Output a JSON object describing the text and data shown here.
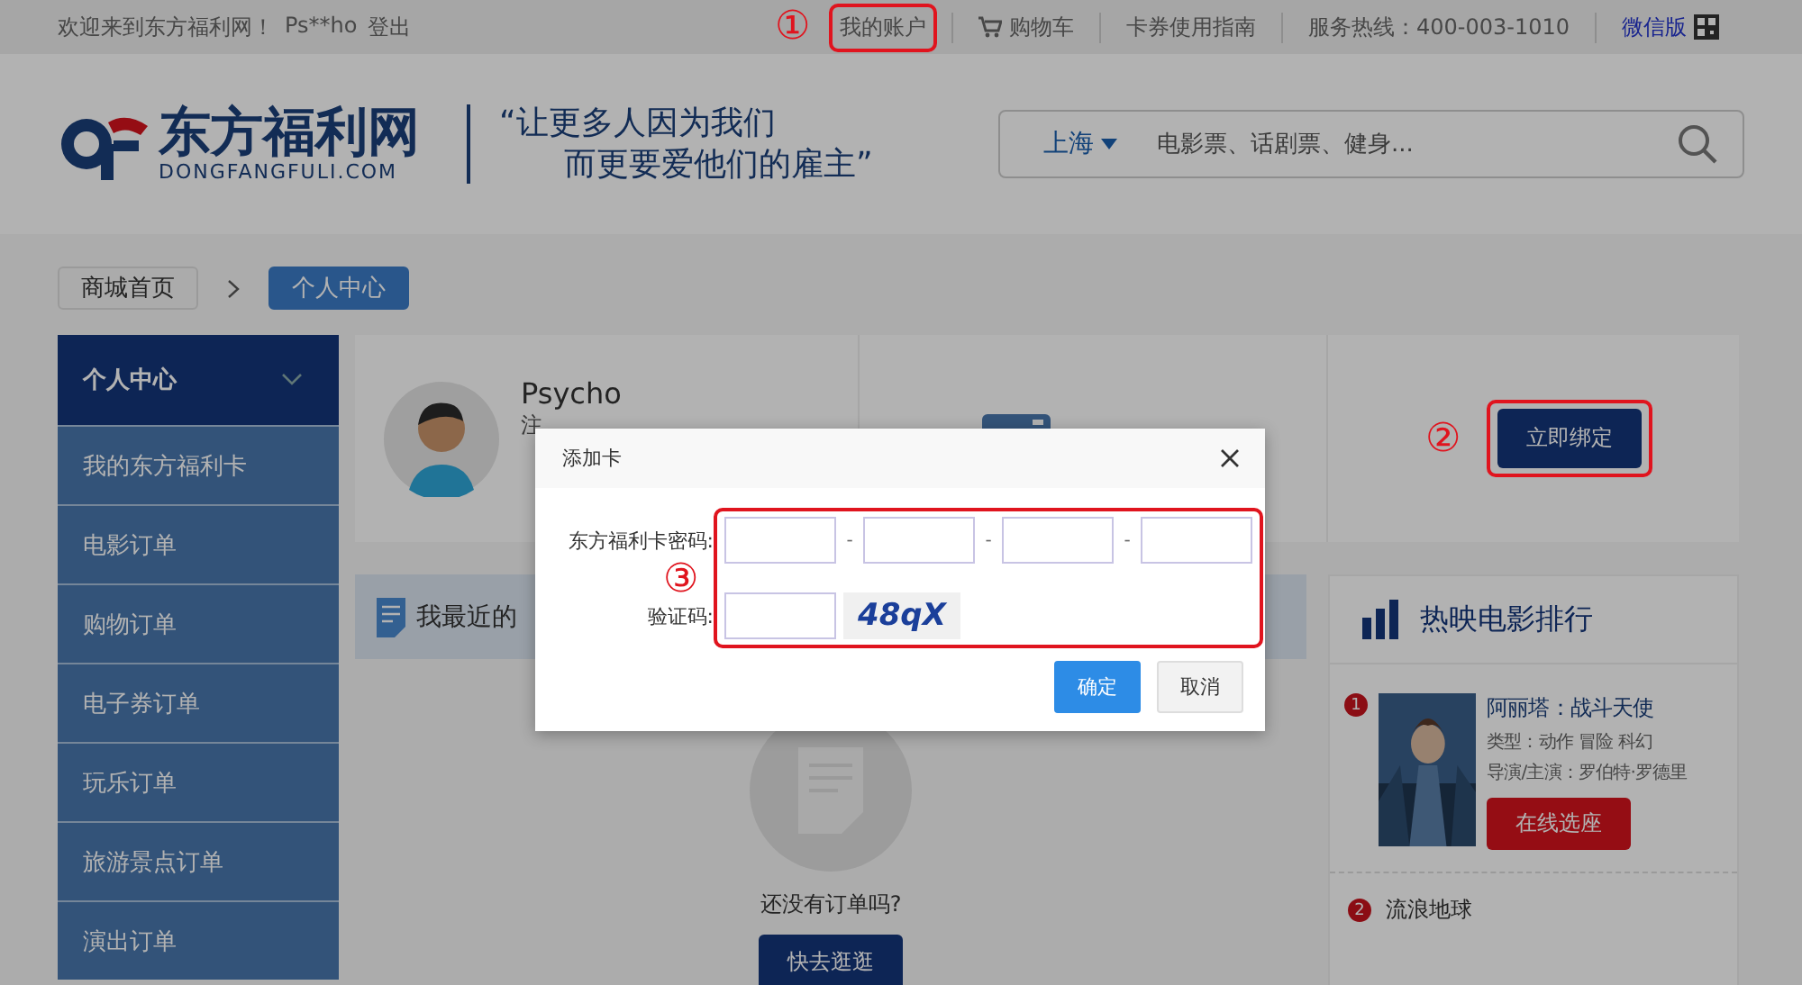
{
  "top_bar": {
    "welcome": "欢迎来到东方福利网！",
    "username": "Ps**ho",
    "logout": "登出",
    "links": [
      {
        "label": "我的账户",
        "kind": "link",
        "annotation": "①"
      },
      {
        "label": "购物车",
        "kind": "cart"
      },
      {
        "label": "卡券使用指南",
        "kind": "link"
      },
      {
        "label": "服务热线：400-003-1010",
        "kind": "text"
      },
      {
        "label": "微信版",
        "kind": "wechat"
      }
    ]
  },
  "header": {
    "logo_name": "东方福利网",
    "logo_domain": "DONGFANGFULI.COM",
    "slogan": [
      "“让更多人因为我们",
      "而更要爱他们的雇主”"
    ],
    "search": {
      "city": "上海",
      "placeholder": "电影票、话剧票、健身..."
    }
  },
  "breadcrumb": [
    {
      "label": "商城首页",
      "selected": false
    },
    {
      "label": "个人中心",
      "selected": true
    }
  ],
  "sidebar": {
    "title": "个人中心",
    "expanded": true,
    "items": [
      "我的东方福利卡",
      "电影订单",
      "购物订单",
      "电子券订单",
      "玩乐订单",
      "旅游景点订单",
      "演出订单"
    ]
  },
  "profile": {
    "name": "Psycho",
    "note": "注",
    "action": "立即绑定",
    "annotation": "②"
  },
  "orders": {
    "title": "我最近的",
    "empty_text": "还没有订单吗?",
    "button": "快去逛逛"
  },
  "movies": {
    "title": "热映电影排行",
    "items": [
      {
        "rank": "1",
        "title": "阿丽塔：战斗天使",
        "genre": "类型：动作 冒险 科幻",
        "cast": "导演/主演：罗伯特·罗德里",
        "button": "在线选座"
      },
      {
        "rank": "2",
        "title": "流浪地球"
      }
    ]
  },
  "dialog": {
    "title": "添加卡",
    "annotation": "③",
    "fields": [
      {
        "kind": "card_password",
        "label": "东方福利卡密码:",
        "separators": [
          "-",
          "-",
          "-"
        ]
      },
      {
        "kind": "captcha",
        "label": "验证码:",
        "code": "48qX"
      }
    ],
    "buttons": [
      {
        "label": "确定",
        "kind": "primary"
      },
      {
        "label": "取消",
        "kind": "secondary"
      }
    ]
  }
}
